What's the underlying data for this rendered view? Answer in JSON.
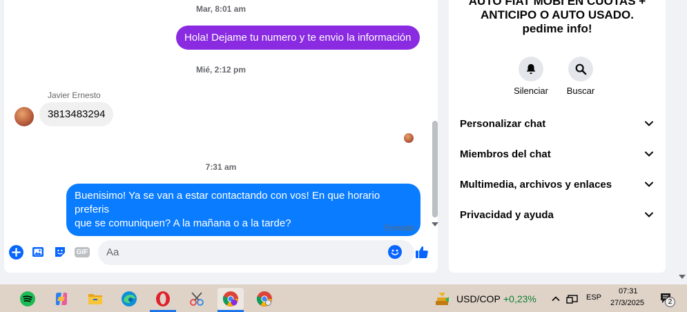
{
  "chat": {
    "timestamps": [
      "Mar, 8:01 am",
      "Mié, 2:12 pm",
      "7:31 am"
    ],
    "messages": [
      {
        "text": "Hola! Dejame tu numero y te envio la información"
      },
      {
        "sender": "Javier Ernesto",
        "text": "3813483294"
      },
      {
        "text_line1": "Buenisimo! Ya se van a estar contactando con vos! En que horario preferis",
        "text_line2": "que se comuniquen? A la mañana o a la tarde?"
      }
    ],
    "status": "Enviado"
  },
  "composer": {
    "placeholder": "Aa",
    "gif_label": "GIF"
  },
  "info": {
    "title_line1": "AUTO FIAT MOBI EN CUOTAS +",
    "title_line2": "ANTICIPO O AUTO USADO.",
    "title_line3": "pedime info!",
    "actions": [
      "Silenciar",
      "Buscar"
    ],
    "menu": [
      "Personalizar chat",
      "Miembros del chat",
      "Multimedia, archivos y enlaces",
      "Privacidad y ayuda"
    ]
  },
  "taskbar": {
    "ticker": "USD/COP",
    "change": "+0,23%",
    "language": "ESP",
    "time": "07:31",
    "date": "27/3/2025",
    "notifications": "2"
  },
  "colors": {
    "purple_bubble": "#8a2be2",
    "blue_bubble": "#0a7cff",
    "messenger_blue": "#0866ff"
  }
}
